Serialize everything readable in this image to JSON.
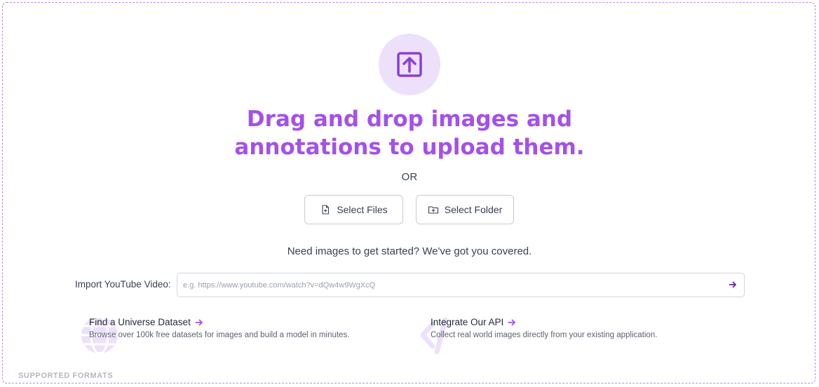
{
  "upload": {
    "headline_line1": "Drag and drop images and",
    "headline_line2": "annotations to upload them.",
    "or_label": "OR"
  },
  "buttons": {
    "select_files": "Select Files",
    "select_folder": "Select Folder"
  },
  "help_text": "Need images to get started? We've got you covered.",
  "youtube": {
    "label": "Import YouTube Video:",
    "placeholder": "e.g. https://www.youtube.com/watch?v=dQw4w9WgXcQ",
    "value": ""
  },
  "promos": {
    "universe": {
      "title": "Find a Universe Dataset",
      "description": "Browse over 100k free datasets for images and build a model in minutes."
    },
    "api": {
      "title": "Integrate Our API",
      "description": "Collect real world images directly from your existing application."
    }
  },
  "formats_heading": "SUPPORTED FORMATS",
  "colors": {
    "accent": "#a351ea",
    "accent_dark": "#8b3fd4",
    "circle_bg": "#ede0fb",
    "border_dashed": "#b48be6"
  },
  "icons": {
    "upload": "upload-arrow-icon",
    "file": "file-plus-icon",
    "folder": "folder-plus-icon",
    "submit": "arrow-right-icon",
    "globe": "globe-icon",
    "code": "code-icon"
  }
}
